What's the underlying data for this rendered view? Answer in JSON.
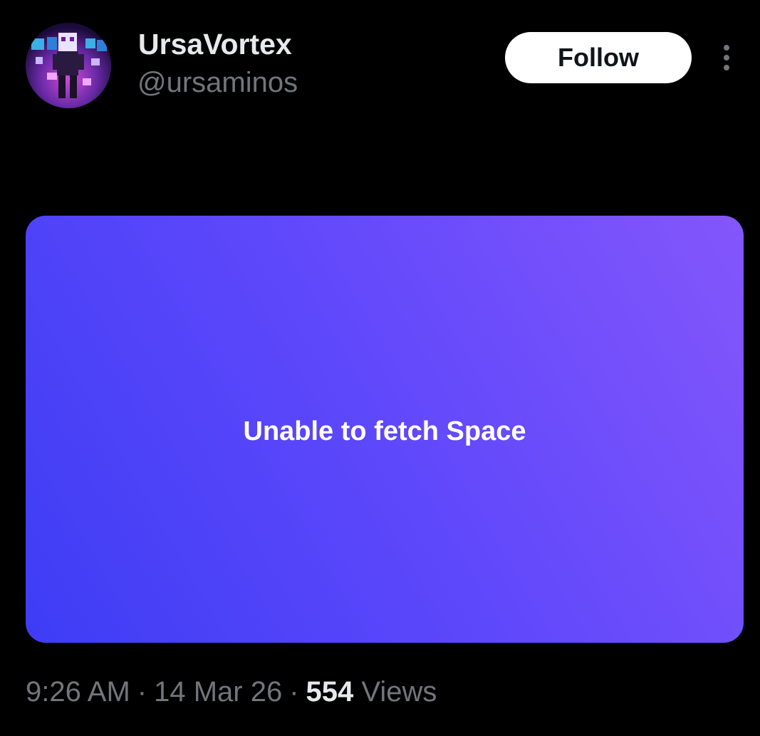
{
  "author": {
    "display_name": "UrsaVortex",
    "handle": "@ursaminos"
  },
  "actions": {
    "follow_label": "Follow",
    "more_icon": "more-vertical-icon"
  },
  "space_card": {
    "message": "Unable to fetch Space",
    "gradient_colors": [
      "#3d3df5",
      "#5f48fb",
      "#8456fb"
    ]
  },
  "meta": {
    "time": "9:26 AM",
    "separator": "·",
    "date": "14 Mar 26",
    "views_count": "554",
    "views_label": "Views"
  },
  "colors": {
    "background": "#000000",
    "primary_text": "#e7e9ea",
    "secondary_text": "#71767b",
    "follow_bg": "#ffffff"
  }
}
